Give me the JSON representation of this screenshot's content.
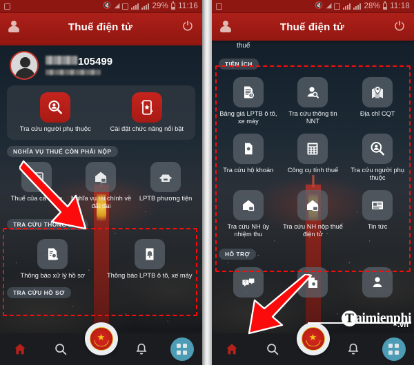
{
  "left": {
    "statusbar": {
      "battery": "29%",
      "time": "11:16",
      "icons": [
        "screenshot-icon",
        "mute-icon",
        "wifi-icon",
        "sim-icon",
        "signal-icon",
        "signal2-icon",
        "battery-icon"
      ]
    },
    "header": {
      "title": "Thuế điện tử",
      "profile_icon": "person-icon",
      "power_icon": "power-icon"
    },
    "profile": {
      "masked_name": "",
      "account_number": "105499"
    },
    "quick_card": {
      "items": [
        {
          "label": "Tra cứu người phụ thuộc",
          "icon": "search-person-icon",
          "style": "red"
        },
        {
          "label": "Cài đặt chức năng nổi bật",
          "icon": "phone-star-icon",
          "style": "red"
        }
      ]
    },
    "sections": [
      {
        "title": "NGHĨA VỤ THUẾ CÒN PHẢI NỘP",
        "items": [
          {
            "label": "Thuế của cá nhân",
            "icon": "id-card-icon"
          },
          {
            "label": "Nghĩa vụ tài chính về đất đai",
            "icon": "house-icon"
          },
          {
            "label": "LPTB phương tiện",
            "icon": "car-icon"
          }
        ]
      },
      {
        "title": "TRA CỨU THÔNG BÁO",
        "highlighted": true,
        "items": [
          {
            "label": "Thông báo xử lý hồ sơ",
            "icon": "doc-search-icon"
          },
          {
            "label": "Thông báo LPTB ô tô, xe máy",
            "icon": "doc-bell-icon"
          }
        ]
      },
      {
        "title": "TRA CỨU HỒ SƠ",
        "items": []
      }
    ],
    "bottomnav": {
      "items": [
        {
          "name": "home",
          "icon": "home-icon"
        },
        {
          "name": "search",
          "icon": "search-icon"
        },
        {
          "name": "emblem",
          "icon": "tax-emblem-icon"
        },
        {
          "name": "notifications",
          "icon": "bell-icon"
        },
        {
          "name": "apps",
          "icon": "grid-icon"
        }
      ]
    }
  },
  "right": {
    "statusbar": {
      "battery": "28%",
      "time": "11:18"
    },
    "header": {
      "title": "Thuế điện tử",
      "profile_icon": "person-icon",
      "power_icon": "power-icon"
    },
    "partial_top_label": "thuế",
    "sections": [
      {
        "title": "TIỆN ÍCH",
        "highlighted": true,
        "rows": [
          [
            {
              "label": "Bảng giá LPTB ô tô, xe máy",
              "icon": "price-doc-icon"
            },
            {
              "label": "Tra cứu thông tin NNT",
              "icon": "person-search-icon"
            },
            {
              "label": "Địa chỉ CQT",
              "icon": "map-pin-icon"
            }
          ],
          [
            {
              "label": "Tra cứu hộ khoán",
              "icon": "doc-search-icon"
            },
            {
              "label": "Công cụ tính thuế",
              "icon": "calculator-icon"
            },
            {
              "label": "Tra cứu người phụ thuộc",
              "icon": "search-person-icon"
            }
          ],
          [
            {
              "label": "Tra cứu NH ủy nhiệm thu",
              "icon": "house-icon"
            },
            {
              "label": "Tra cứu NH nộp thuế điện tử",
              "icon": "house-icon"
            },
            {
              "label": "Tin tức",
              "icon": "news-icon"
            }
          ]
        ]
      },
      {
        "title": "HỖ TRỢ",
        "rows": [
          [
            {
              "label": "",
              "icon": "chat-question-icon"
            },
            {
              "label": "",
              "icon": "doc-search-icon"
            },
            {
              "label": "",
              "icon": "person-icon"
            }
          ]
        ]
      }
    ],
    "bottomnav": {
      "items": [
        {
          "name": "home",
          "icon": "home-icon"
        },
        {
          "name": "search",
          "icon": "search-icon"
        },
        {
          "name": "emblem",
          "icon": "tax-emblem-icon"
        },
        {
          "name": "notifications",
          "icon": "bell-icon"
        },
        {
          "name": "apps",
          "icon": "grid-icon"
        }
      ]
    }
  },
  "watermark": {
    "logo_letter": "T",
    "text": "aimienphi",
    "domain": ".vn"
  },
  "annotations": {
    "highlight_color": "#fb0b0b",
    "arrows": [
      {
        "panel": "left",
        "direction": "down-right"
      },
      {
        "panel": "right",
        "direction": "up-right"
      }
    ]
  },
  "colors": {
    "header_red": "#a81a14",
    "tile_red": "#c5241d",
    "accent_teal": "#4b9cb4",
    "status_red": "#8f1712"
  }
}
